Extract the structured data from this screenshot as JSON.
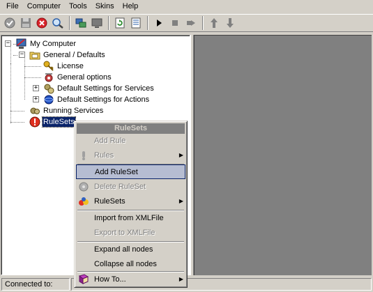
{
  "menu": [
    "File",
    "Computer",
    "Tools",
    "Skins",
    "Help"
  ],
  "tree": {
    "root": "My Computer",
    "general": "General / Defaults",
    "license": "License",
    "general_options": "General options",
    "default_services": "Default Settings for Services",
    "default_actions": "Default Settings for Actions",
    "running_services": "Running Services",
    "rulesets": "RuleSets"
  },
  "context_menu": {
    "title": "RuleSets",
    "items": [
      {
        "label": "Add Rule",
        "enabled": false
      },
      {
        "label": "Rules",
        "enabled": false,
        "submenu": true
      },
      {
        "label": "Add RuleSet",
        "enabled": true,
        "highlighted": true
      },
      {
        "label": "Delete RuleSet",
        "enabled": false
      },
      {
        "label": "RuleSets",
        "enabled": true,
        "submenu": true
      },
      {
        "label": "Import from XMLFile",
        "enabled": true
      },
      {
        "label": "Export to XMLFile",
        "enabled": false
      },
      {
        "label": "Expand all nodes",
        "enabled": true
      },
      {
        "label": "Collapse all nodes",
        "enabled": true
      },
      {
        "label": "How To...",
        "enabled": true,
        "submenu": true
      }
    ]
  },
  "status": {
    "connected_label": "Connected to:"
  },
  "colors": {
    "face": "#d4d0c8",
    "selection": "#0a246a",
    "menu_highlight": "#b6bdd2",
    "right_pane": "#808080"
  }
}
